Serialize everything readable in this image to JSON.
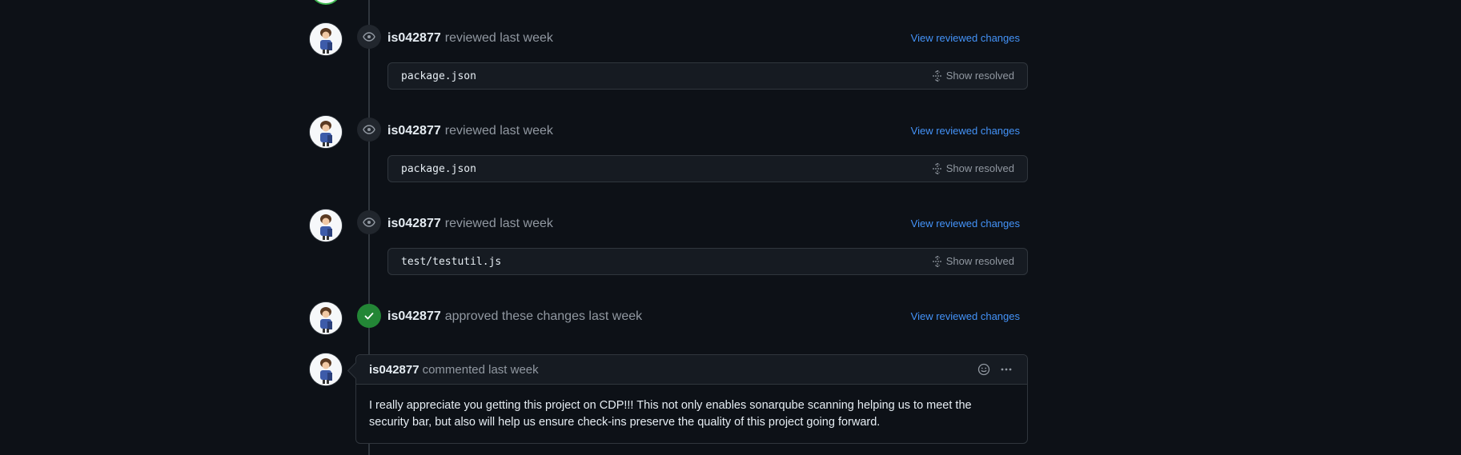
{
  "events": [
    {
      "author": "is042877",
      "action": "reviewed last week",
      "link": "View reviewed changes",
      "file": "package.json",
      "resolved_label": "Show resolved"
    },
    {
      "author": "is042877",
      "action": "reviewed last week",
      "link": "View reviewed changes",
      "file": "package.json",
      "resolved_label": "Show resolved"
    },
    {
      "author": "is042877",
      "action": "reviewed last week",
      "link": "View reviewed changes",
      "file": "test/testutil.js",
      "resolved_label": "Show resolved"
    },
    {
      "author": "is042877",
      "action": "approved these changes last week",
      "link": "View reviewed changes"
    }
  ],
  "comment": {
    "author": "is042877",
    "action": "commented last week",
    "body": "I really appreciate you getting this project on CDP!!! This not only enables sonarqube scanning helping us to meet the security bar, but also will help us ensure check-ins preserve the quality of this project going forward."
  },
  "icons": {
    "review": "eye-icon",
    "approve": "check-icon",
    "resolve": "unfold-icon",
    "reaction": "smiley-icon",
    "menu": "kebab-horizontal-icon"
  },
  "colors": {
    "background": "#0d1117",
    "link": "#4493f8",
    "approved": "#238636",
    "muted": "#9198a1"
  }
}
